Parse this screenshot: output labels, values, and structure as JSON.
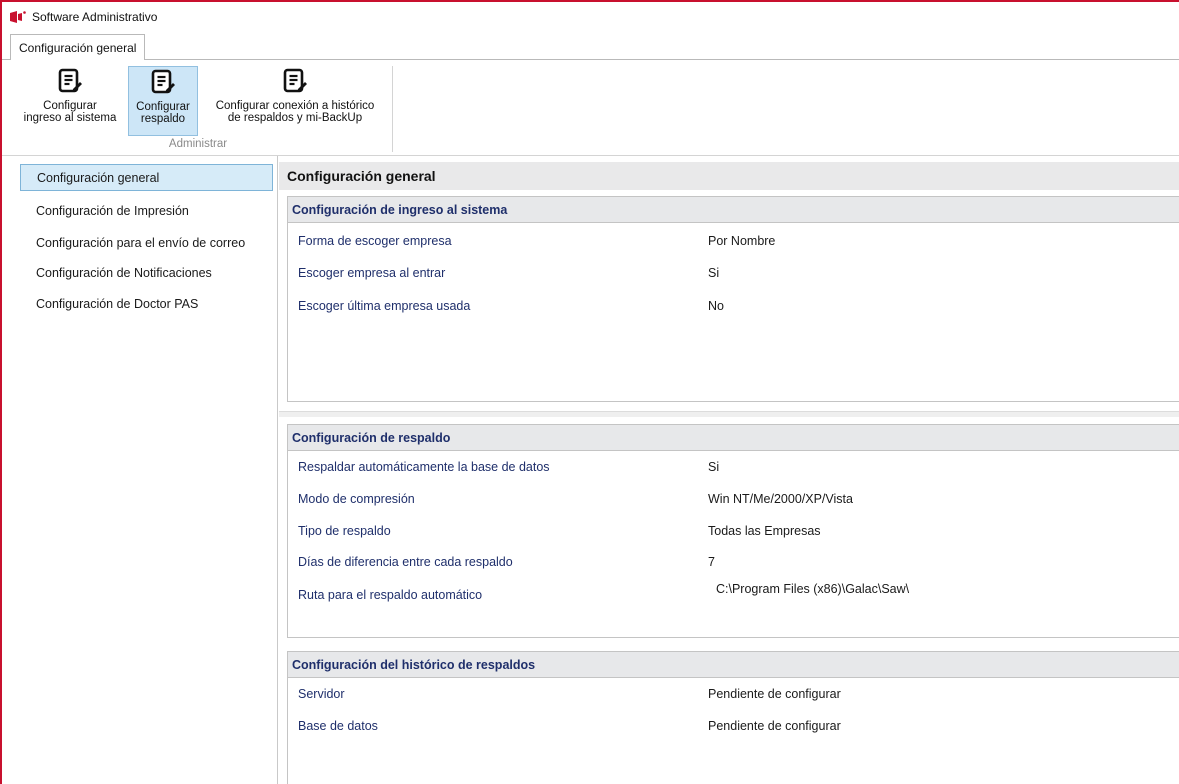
{
  "window": {
    "title": "Software Administrativo",
    "logo_icon": "app-logo-icon",
    "accent_color": "#c8102e"
  },
  "tabs": [
    {
      "label": "Configuración general",
      "active": true
    }
  ],
  "ribbon": {
    "buttons": [
      {
        "line1": "Configurar",
        "line2": "ingreso al sistema",
        "icon": "document-edit-icon",
        "active": false
      },
      {
        "line1": "Configurar",
        "line2": "respaldo",
        "icon": "document-edit-icon",
        "active": true
      },
      {
        "line1": "Configurar conexión a histórico",
        "line2": "de respaldos y mi-BackUp",
        "icon": "document-edit-icon",
        "active": false
      }
    ],
    "group_label": "Administrar"
  },
  "sidebar": {
    "items": [
      {
        "label": "Configuración general",
        "selected": true
      },
      {
        "label": "Configuración de Impresión",
        "selected": false
      },
      {
        "label": "Configuración para el envío de correo",
        "selected": false
      },
      {
        "label": "Configuración de Notificaciones",
        "selected": false
      },
      {
        "label": "Configuración de Doctor PAS",
        "selected": false
      }
    ]
  },
  "main": {
    "title": "Configuración general",
    "sections": [
      {
        "title": "Configuración de ingreso al sistema",
        "rows": [
          {
            "key": "Forma de escoger empresa",
            "value": "Por Nombre"
          },
          {
            "key": "Escoger empresa al entrar",
            "value": "Si"
          },
          {
            "key": "Escoger última empresa usada",
            "value": "No"
          }
        ]
      },
      {
        "title": "Configuración de respaldo",
        "rows": [
          {
            "key": "Respaldar automáticamente la base de datos",
            "value": "Si"
          },
          {
            "key": "Modo de compresión",
            "value": "Win NT/Me/2000/XP/Vista"
          },
          {
            "key": "Tipo de respaldo",
            "value": "Todas las Empresas"
          },
          {
            "key": "Días de diferencia entre cada respaldo",
            "value": "7"
          },
          {
            "key": "Ruta para el respaldo automático",
            "value": "C:\\Program Files (x86)\\Galac\\Saw\\"
          }
        ]
      },
      {
        "title": "Configuración del histórico de respaldos",
        "rows": [
          {
            "key": "Servidor",
            "value": "Pendiente de configurar"
          },
          {
            "key": "Base de datos",
            "value": "Pendiente de configurar"
          }
        ]
      }
    ]
  }
}
